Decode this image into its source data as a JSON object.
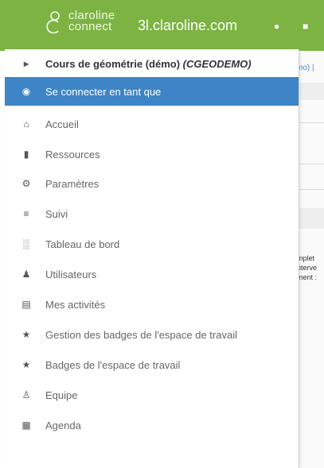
{
  "topbar": {
    "logo_line1": "claroline",
    "logo_line2": "connect",
    "site_name": "3l.claroline.com",
    "icons": [
      "home-icon",
      "list-icon"
    ]
  },
  "background": {
    "link_text": "mo) |",
    "text_lines": [
      "mplet",
      "nterve",
      "ment :"
    ]
  },
  "menu": {
    "header": {
      "icon": "caret-right-icon",
      "label": "Cours de géométrie (démo)",
      "code": "(CGEODEMO)"
    },
    "items": [
      {
        "icon": "eye-icon",
        "label": "Se connecter en tant que",
        "active": true
      },
      {
        "icon": "home-icon",
        "label": "Accueil"
      },
      {
        "icon": "folder-icon",
        "label": "Ressources"
      },
      {
        "icon": "gears-icon",
        "label": "Paramètres"
      },
      {
        "icon": "list-icon",
        "label": "Suivi"
      },
      {
        "icon": "bar-chart-icon",
        "label": "Tableau de bord"
      },
      {
        "icon": "user-icon",
        "label": "Utilisateurs"
      },
      {
        "icon": "tasks-icon",
        "label": "Mes activités"
      },
      {
        "icon": "trophy-icon",
        "label": "Gestion des badges de l'espace de travail"
      },
      {
        "icon": "trophy-icon",
        "label": "Badges de l'espace de travail"
      },
      {
        "icon": "group-icon",
        "label": "Equipe"
      },
      {
        "icon": "calendar-icon",
        "label": "Agenda"
      }
    ]
  },
  "colors": {
    "topbar": "#7cb342",
    "active": "#3d85c6"
  }
}
